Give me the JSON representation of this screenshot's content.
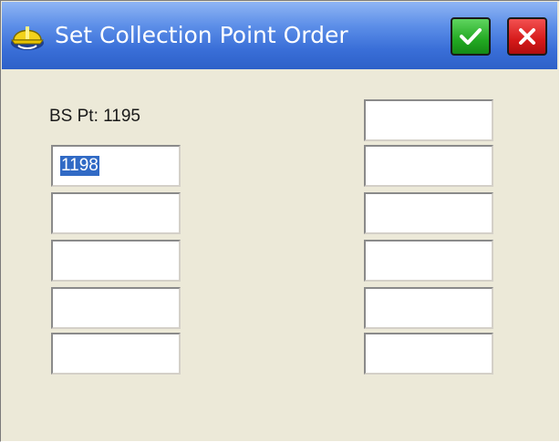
{
  "window": {
    "title": "Set Collection Point Order",
    "ok_icon": "checkmark-icon",
    "cancel_icon": "close-icon",
    "accent_titlebar": "#3a6fd8",
    "ok_color": "#22a922",
    "cancel_color": "#d61a1a"
  },
  "form": {
    "bs_label": "BS Pt: 1195",
    "left_fields": [
      {
        "value": "1198",
        "selected": true
      },
      {
        "value": ""
      },
      {
        "value": ""
      },
      {
        "value": ""
      },
      {
        "value": ""
      }
    ],
    "right_fields": [
      {
        "value": ""
      },
      {
        "value": ""
      },
      {
        "value": ""
      },
      {
        "value": ""
      },
      {
        "value": ""
      },
      {
        "value": ""
      }
    ]
  }
}
